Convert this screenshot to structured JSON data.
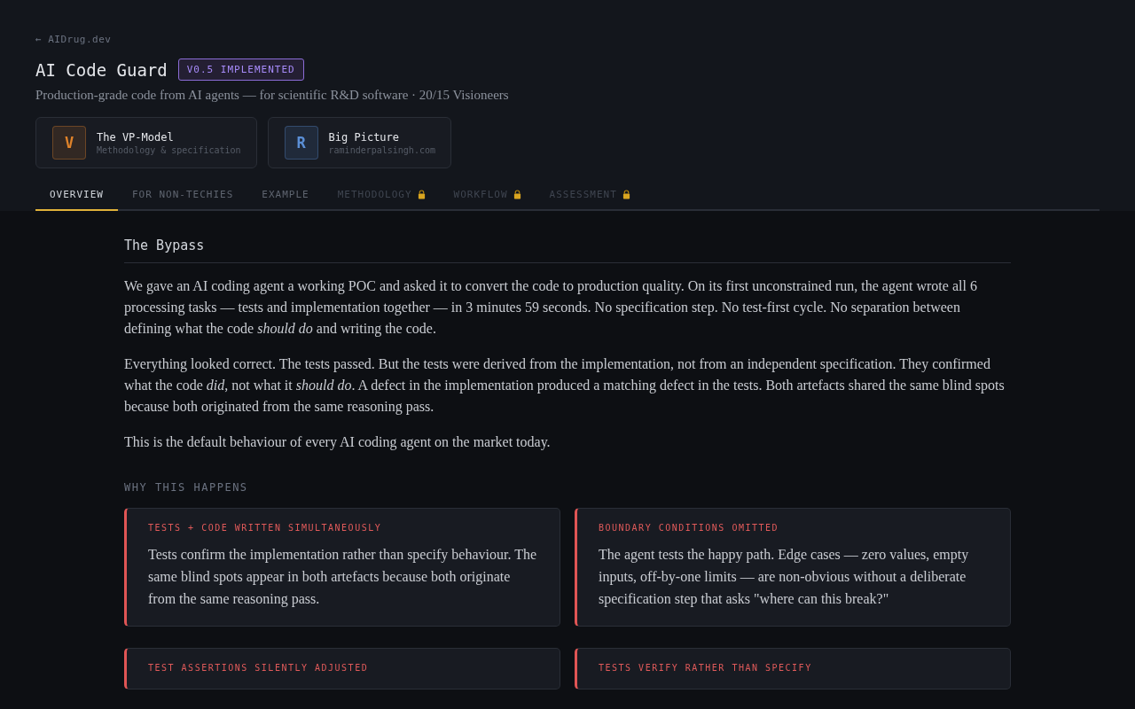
{
  "back_link": {
    "arrow": "←",
    "label": "AIDrug.dev"
  },
  "title": "AI Code Guard",
  "status_badge": "V0.5 IMPLEMENTED",
  "subtitle": "Production-grade code from AI agents — for scientific R&D software · 20/15 Visioneers",
  "link_cards": [
    {
      "letter": "V",
      "title": "The VP-Model",
      "subtitle": "Methodology & specification",
      "color": "#e0832a"
    },
    {
      "letter": "R",
      "title": "Big Picture",
      "subtitle": "raminderpalsingh.com",
      "color": "#5b8fd6"
    }
  ],
  "tabs": [
    {
      "label": "OVERVIEW",
      "selected": true,
      "locked": false
    },
    {
      "label": "FOR NON-TECHIES",
      "selected": false,
      "locked": false
    },
    {
      "label": "EXAMPLE",
      "selected": false,
      "locked": false
    },
    {
      "label": "METHODOLOGY",
      "selected": false,
      "locked": true
    },
    {
      "label": "WORKFLOW",
      "selected": false,
      "locked": true
    },
    {
      "label": "ASSESSMENT",
      "selected": false,
      "locked": true
    }
  ],
  "section": {
    "heading": "The Bypass",
    "paragraphs": [
      "We gave an AI coding agent a working POC and asked it to convert the code to production quality. On its first unconstrained run, the agent wrote all 6 processing tasks — tests and implementation together — in 3 minutes 59 seconds. No specification step. No test-first cycle. No separation between defining what the code *should do* and writing the code.",
      "Everything looked correct. The tests passed. But the tests were derived from the implementation, not from an independent specification. They confirmed what the code *did*, not what it *should do*. A defect in the implementation produced a matching defect in the tests. Both artefacts shared the same blind spots because both originated from the same reasoning pass.",
      "This is the default behaviour of every AI coding agent on the market today."
    ],
    "subheading": "WHY THIS HAPPENS",
    "cards": [
      {
        "title": "TESTS + CODE WRITTEN SIMULTANEOUSLY",
        "body": "Tests confirm the implementation rather than specify behaviour. The same blind spots appear in both artefacts because both originate from the same reasoning pass."
      },
      {
        "title": "BOUNDARY CONDITIONS OMITTED",
        "body": "The agent tests the happy path. Edge cases — zero values, empty inputs, off-by-one limits — are non-obvious without a deliberate specification step that asks \"where can this break?\""
      },
      {
        "title": "TEST ASSERTIONS SILENTLY ADJUSTED"
      },
      {
        "title": "TESTS VERIFY RATHER THAN SPECIFY"
      }
    ]
  }
}
